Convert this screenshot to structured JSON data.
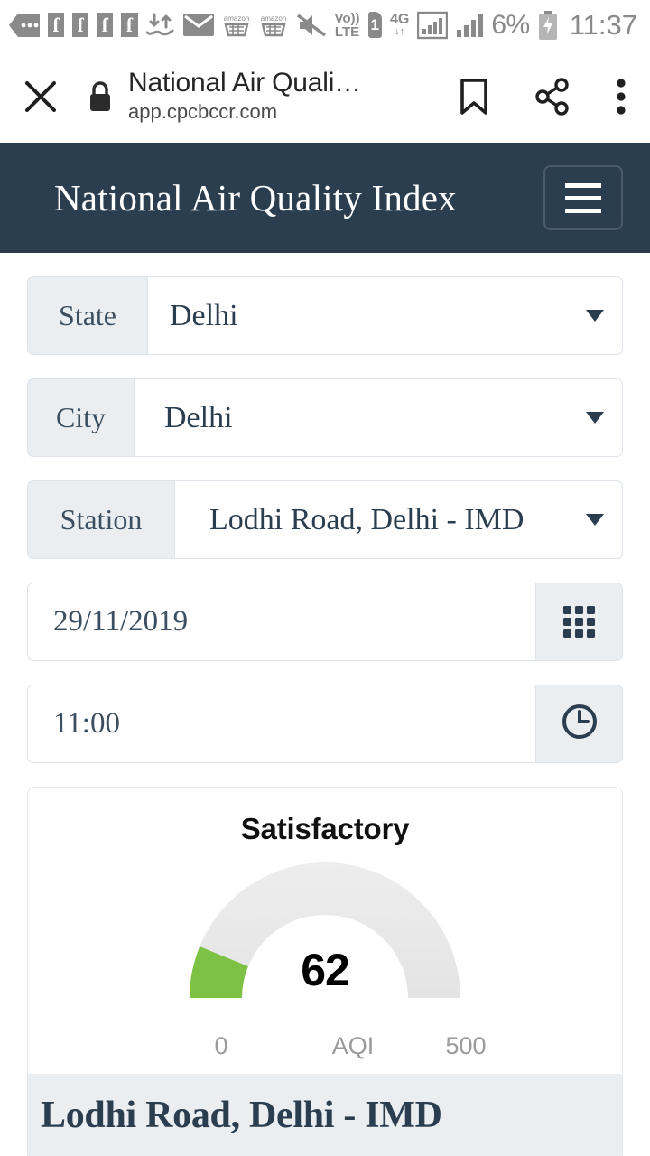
{
  "status_bar": {
    "icons": [
      "more-messages-badge",
      "facebook-icon",
      "facebook-icon",
      "facebook-icon",
      "facebook-icon",
      "sync-transfer-icon",
      "email-icon",
      "amazon-cart-icon",
      "amazon-cart-icon",
      "mute-icon"
    ],
    "volte_label": "Vo)) LTE",
    "sim_label": "1",
    "network_type": "4G",
    "battery_percent": "6%",
    "time": "11:37"
  },
  "browser": {
    "close_label": "✕",
    "lock_icon": "lock-icon",
    "page_title": "National Air Quali…",
    "url": "app.cpcbccr.com",
    "bookmark_icon": "bookmark-icon",
    "share_icon": "share-icon",
    "menu_icon": "overflow-menu-icon"
  },
  "app_header": {
    "title": "National Air Quality Index",
    "menu_button": "hamburger-menu",
    "background_color": "#2b3e50"
  },
  "form": {
    "state": {
      "label": "State",
      "value": "Delhi"
    },
    "city": {
      "label": "City",
      "value": "Delhi"
    },
    "station": {
      "label": "Station",
      "value": "Lodhi Road, Delhi - IMD"
    },
    "date": {
      "value": "29/11/2019",
      "icon": "calendar-grid-icon"
    },
    "time": {
      "value": "11:00",
      "icon": "clock-icon"
    }
  },
  "chart_data": {
    "type": "gauge",
    "title": "Satisfactory",
    "value": 62,
    "unit_label": "AQI",
    "min": 0,
    "max": 500,
    "min_label": "0",
    "max_label": "500",
    "value_label": "62",
    "fill_color": "#7dc244",
    "track_color": "#e9e9e9",
    "categories": [
      "AQI"
    ],
    "values": [
      62
    ],
    "ylim": [
      0,
      500
    ],
    "annotations": [
      "Satisfactory"
    ]
  },
  "card": {
    "footer_station": "Lodhi Road, Delhi - IMD"
  }
}
